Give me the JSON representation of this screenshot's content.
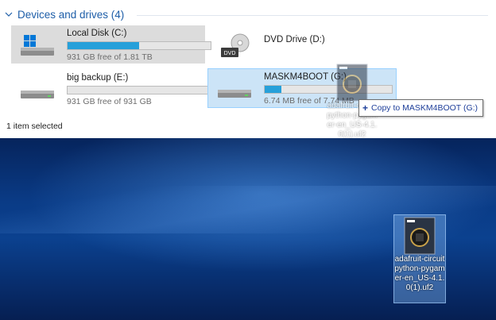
{
  "group": {
    "title": "Devices and drives (4)"
  },
  "drives": [
    {
      "name": "Local Disk (C:)",
      "free": "931 GB free of 1.81 TB",
      "used_fraction": 0.5
    },
    {
      "name": "DVD Drive (D:)"
    },
    {
      "name": "big backup (E:)",
      "free": "931 GB free of 931 GB",
      "used_fraction": 0.0
    },
    {
      "name": "MASKM4BOOT (G:)",
      "free": "6.74 MB free of 7.74 MB",
      "used_fraction": 0.13
    }
  ],
  "status": {
    "selection": "1 item selected"
  },
  "drag": {
    "tooltip_action": "Copy to MASKM4BOOT (G:)",
    "ghost_label": "adafruit-circuitpython-pygamer-en_US-4.1.0(1).uf2"
  },
  "desktop_file": {
    "label": "adafruit-circuitpython-pygamer-en_US-4.1.0(1).uf2"
  },
  "colors": {
    "accent": "#26a0da",
    "link": "#1e5ea8",
    "hover_bg": "#cce4f7"
  }
}
